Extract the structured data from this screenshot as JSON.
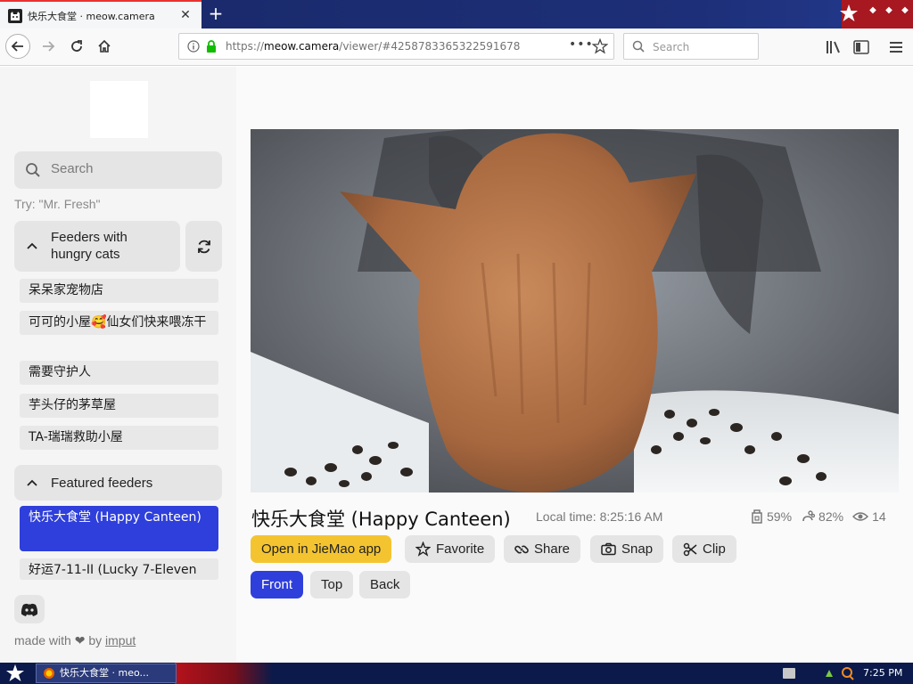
{
  "browser": {
    "tab_title": "快乐大食堂 · meow.camera",
    "url_host": "meow.camera",
    "url_path": "/viewer/#4258783365322591678",
    "url_prefix": "https://",
    "search_placeholder": "Search",
    "dots": "•••"
  },
  "sidebar": {
    "search_placeholder": "Search",
    "try_hint": "Try: \"Mr. Fresh\"",
    "hungry_section": {
      "label": "Feeders with hungry cats",
      "items": [
        "呆呆家宠物店",
        "可可的小屋🥰仙女们快来喂冻干",
        "需要守护人",
        "芋头仔的茅草屋",
        "TA-瑞瑞救助小屋"
      ]
    },
    "featured_section": {
      "label": "Featured feeders",
      "items": [
        "快乐大食堂 (Happy Canteen)",
        "好运7-11-II (Lucky 7-Eleven"
      ]
    },
    "footer": {
      "made_with": "made with",
      "by": "by",
      "author": "imput"
    }
  },
  "viewer": {
    "title": "快乐大食堂 (Happy Canteen)",
    "local_time": "Local time: 8:25:16 AM",
    "stats": {
      "food": "59%",
      "health": "82%",
      "viewers": "14"
    },
    "actions": {
      "open_app": "Open in JieMao app",
      "favorite": "Favorite",
      "share": "Share",
      "snap": "Snap",
      "clip": "Clip"
    },
    "views": {
      "front": "Front",
      "top": "Top",
      "back": "Back"
    }
  },
  "taskbar": {
    "task_label": "快乐大食堂 · meo...",
    "clock": "7:25 PM"
  },
  "colors": {
    "accent_blue": "#2f3fdb",
    "primary_yellow": "#f4c430",
    "tab_accent": "#e8322f"
  }
}
